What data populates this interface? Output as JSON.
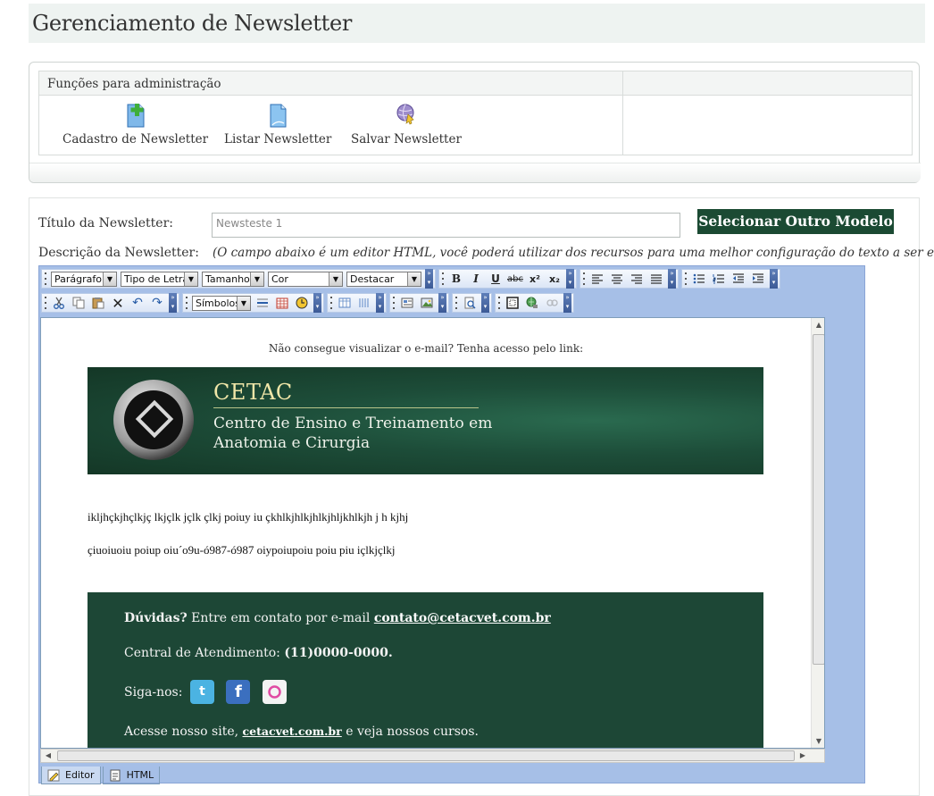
{
  "header": {
    "title": "Gerenciamento de Newsletter"
  },
  "admin": {
    "heading": "Funções para administração",
    "functions": [
      {
        "label": "Cadastro de Newsletter",
        "icon": "new-document-icon"
      },
      {
        "label": "Listar Newsletter",
        "icon": "document-icon"
      },
      {
        "label": "Salvar Newsletter",
        "icon": "save-globe-icon"
      }
    ]
  },
  "form": {
    "title_label": "Título da Newsletter:",
    "title_value": "Newsteste 1",
    "select_model_button": "Selecionar Outro Modelo",
    "description_label": "Descrição da Newsletter:",
    "description_hint": "(O campo abaixo é um editor HTML, você poderá utilizar dos recursos para uma melhor configuração do texto a ser editado)"
  },
  "editor": {
    "selects": {
      "paragraph": "Parágrafo",
      "font": "Tipo de Letra",
      "size": "Tamanho",
      "color": "Cor",
      "highlight": "Destacar",
      "symbols": "Símbolos"
    },
    "format_buttons": {
      "bold": "B",
      "italic": "I",
      "underline": "U",
      "strike": "abc",
      "superscript": "x²",
      "subscript": "x₂"
    },
    "tabs": {
      "editor": "Editor",
      "html": "HTML"
    }
  },
  "newsletter": {
    "view_link_note": "Não consegue visualizar o e-mail? Tenha acesso pelo link:",
    "banner_title": "CETAC",
    "banner_sub_1": "Centro de Ensino e Treinamento em",
    "banner_sub_2": "Anatomia e Cirurgia",
    "body_line_1": "ikljhçkjhçlkjç lkjçlk jçlk çlkj poiuy iu çkhlkjhlkjhlkjhljkhlkjh j h kjhj",
    "body_line_2": "çiuoiuoiu poiup oiu´o9u-ó987-ó987 oiypoiupoiu poiu piu içlkjçlkj",
    "doubts_bold": "Dúvidas?",
    "doubts_text": " Entre em contato por e-mail ",
    "email": "contato@cetacvet.com.br",
    "central_label": "Central de Atendimento: ",
    "central_phone": "(11)0000-0000.",
    "follow_label": "Siga-nos:",
    "site_prefix": "Acesse nosso site, ",
    "site_link": "cetacvet.com.br",
    "site_suffix": " e veja nossos cursos."
  },
  "colors": {
    "brand_green": "#1b4a33",
    "footer_green": "#1d4736",
    "editor_blue": "#a6bfe7",
    "twitter": "#4bb3e2",
    "facebook": "#3b6fbf",
    "flickr": "#f3f3f3"
  }
}
